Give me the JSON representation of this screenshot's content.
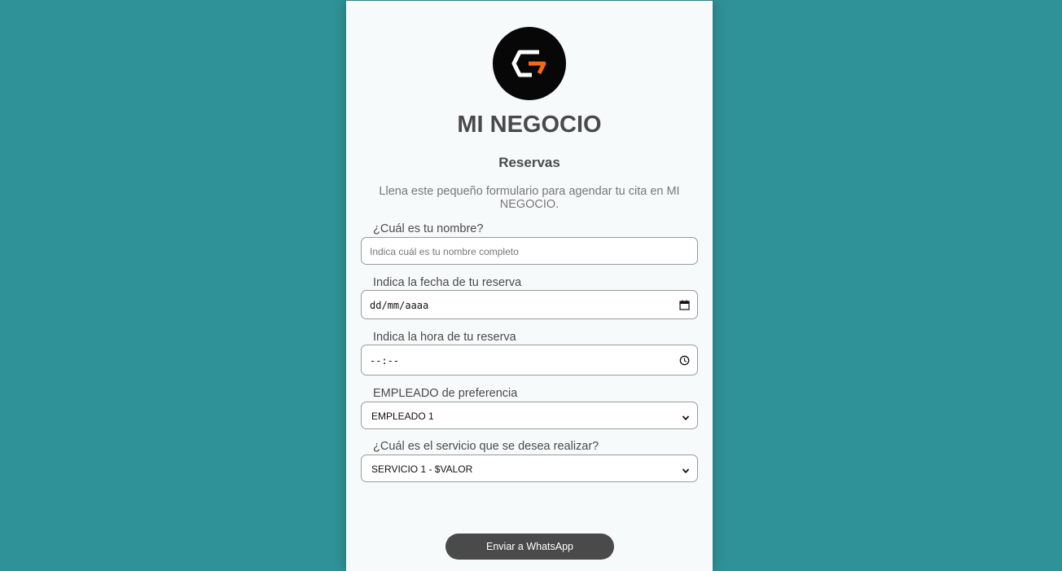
{
  "brand": {
    "name": "MI NEGOCIO"
  },
  "form": {
    "title": "Reservas",
    "description": "Llena este pequeño formulario para agendar tu cita en MI NEGOCIO.",
    "name_label": "¿Cuál es tu nombre?",
    "name_placeholder": "Indica cuál es tu nombre completo",
    "date_label": "Indica la fecha de tu reserva",
    "date_value": "dd/mm/aaaa",
    "time_label": "Indica la hora de tu reserva",
    "time_value": "--:--",
    "employee_label": "EMPLEADO de preferencia",
    "employee_selected": "EMPLEADO 1",
    "service_label": "¿Cuál es el servicio que se desea realizar?",
    "service_selected": "SERVICIO 1 - $VALOR",
    "submit_label": "Enviar a WhatsApp"
  },
  "colors": {
    "page_background": "#2f9298",
    "card_background": "#f7fafb",
    "logo_background": "#070707",
    "logo_accent": "#f26a1b",
    "button_background": "#4a4a4a"
  },
  "icons": {
    "date": "calendar-icon",
    "time": "clock-icon",
    "select": "chevron-down-icon"
  }
}
